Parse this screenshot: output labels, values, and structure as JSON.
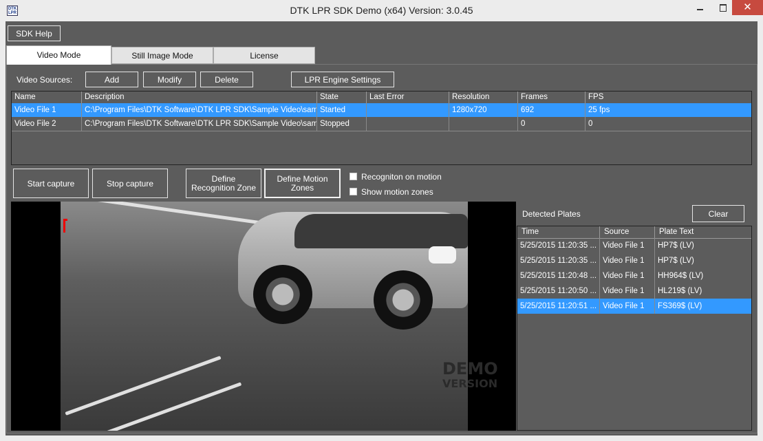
{
  "window": {
    "title": "DTK LPR SDK Demo (x64) Version: 3.0.45",
    "icon_text": "DTK LPR"
  },
  "toolbar": {
    "sdk_help": "SDK Help"
  },
  "tabs": [
    {
      "label": "Video Mode"
    },
    {
      "label": "Still Image Mode"
    },
    {
      "label": "License"
    }
  ],
  "sources": {
    "label": "Video Sources:",
    "add": "Add",
    "modify": "Modify",
    "delete": "Delete",
    "engine_settings": "LPR Engine Settings",
    "columns": [
      "Name",
      "Description",
      "State",
      "Last Error",
      "Resolution",
      "Frames",
      "FPS"
    ],
    "rows": [
      {
        "name": "Video File 1",
        "description": "C:\\Program Files\\DTK Software\\DTK LPR SDK\\Sample Video\\samp...",
        "state": "Started",
        "last_error": "",
        "resolution": "1280x720",
        "frames": "692",
        "fps": "25 fps"
      },
      {
        "name": "Video File 2",
        "description": "C:\\Program Files\\DTK Software\\DTK LPR SDK\\Sample Video\\samp...",
        "state": "Stopped",
        "last_error": "",
        "resolution": "",
        "frames": "0",
        "fps": "0"
      }
    ]
  },
  "controls": {
    "start_capture": "Start capture",
    "stop_capture": "Stop capture",
    "define_recognition_zone": "Define Recognition Zone",
    "define_motion_zones": "Define Motion Zones",
    "recognition_on_motion": "Recogniton on motion",
    "show_motion_zones": "Show motion zones"
  },
  "video": {
    "watermark_line1": "DEMO",
    "watermark_line2": "VERSION"
  },
  "plates": {
    "title": "Detected Plates",
    "clear": "Clear",
    "columns": [
      "Time",
      "Source",
      "Plate Text"
    ],
    "rows": [
      {
        "time": "5/25/2015 11:20:35 ...",
        "source": "Video File 1",
        "plate": "HP7$ (LV)"
      },
      {
        "time": "5/25/2015 11:20:35 ...",
        "source": "Video File 1",
        "plate": "HP7$ (LV)"
      },
      {
        "time": "5/25/2015 11:20:48 ...",
        "source": "Video File 1",
        "plate": "HH964$ (LV)"
      },
      {
        "time": "5/25/2015 11:20:50 ...",
        "source": "Video File 1",
        "plate": "HL219$ (LV)"
      },
      {
        "time": "5/25/2015 11:20:51 ...",
        "source": "Video File 1",
        "plate": "FS369$ (LV)"
      }
    ]
  },
  "colors": {
    "accent": "#3399ff",
    "background": "#5c5c5c",
    "close": "#c74a3f"
  }
}
